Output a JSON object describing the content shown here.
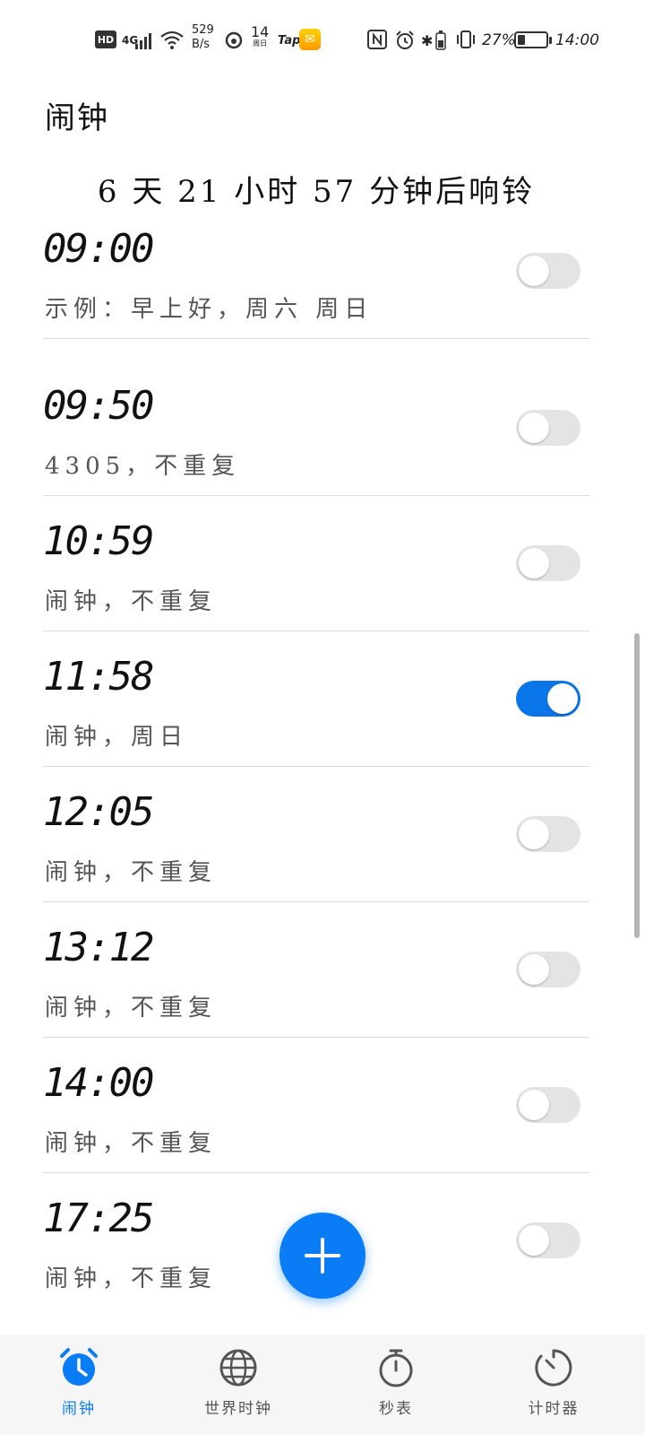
{
  "status_bar": {
    "hd": "HD",
    "network": "4G",
    "speed_value": "529",
    "speed_unit": "B/s",
    "date_day": "14",
    "date_sub": "周日",
    "tap": "Tap",
    "battery_percent": "27%",
    "battery_level": 0.27,
    "time": "14:00"
  },
  "header": {
    "title": "闹钟",
    "countdown": "6 天 21 小时 57 分钟后响铃"
  },
  "alarms": [
    {
      "time": "09:00",
      "label": "示例：早上好，周六 周日",
      "enabled": false
    },
    {
      "time": "09:50",
      "label": "4305，不重复",
      "enabled": false
    },
    {
      "time": "10:59",
      "label": "闹钟，不重复",
      "enabled": false
    },
    {
      "time": "11:58",
      "label": "闹钟，周日",
      "enabled": true
    },
    {
      "time": "12:05",
      "label": "闹钟，不重复",
      "enabled": false
    },
    {
      "time": "13:12",
      "label": "闹钟，不重复",
      "enabled": false
    },
    {
      "time": "14:00",
      "label": "闹钟，不重复",
      "enabled": false
    },
    {
      "time": "17:25",
      "label": "闹钟，不重复",
      "enabled": false
    }
  ],
  "fab": {
    "icon": "plus-icon"
  },
  "nav": {
    "items": [
      {
        "label": "闹钟",
        "icon": "alarm-clock-icon",
        "active": true
      },
      {
        "label": "世界时钟",
        "icon": "globe-icon",
        "active": false
      },
      {
        "label": "秒表",
        "icon": "stopwatch-icon",
        "active": false
      },
      {
        "label": "计时器",
        "icon": "timer-icon",
        "active": false
      }
    ]
  },
  "colors": {
    "accent": "#0a7cf5",
    "toggle_on": "#0a75e8",
    "toggle_off": "#e4e4e4"
  }
}
